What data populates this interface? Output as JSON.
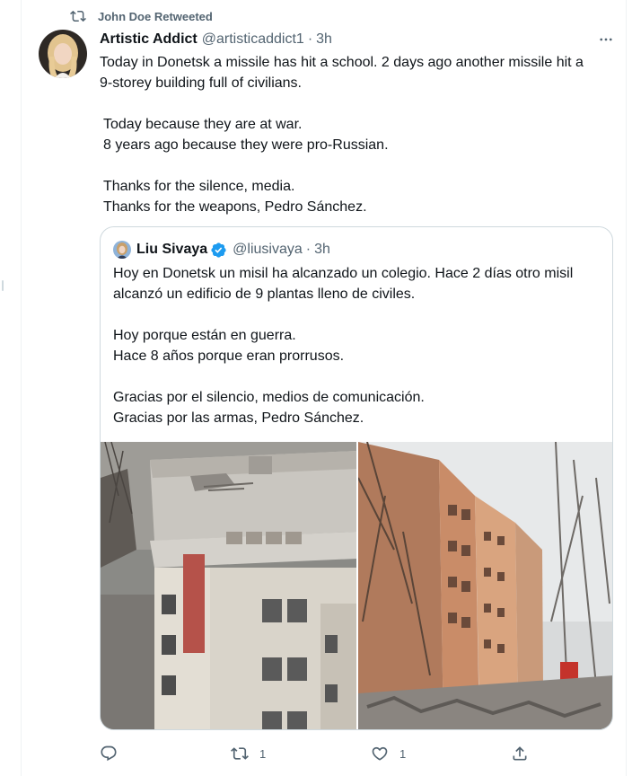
{
  "retweet_context": {
    "icon": "retweet-icon",
    "text": "John Doe Retweeted"
  },
  "tweet": {
    "author": {
      "display_name": "Artistic Addict",
      "handle": "@artisticaddict1",
      "separator": "·",
      "time": "3h"
    },
    "more_icon": "more-horizontal-icon",
    "lines": {
      "l1": "Today in Donetsk a missile has hit a school. 2 days ago another missile hit a",
      "l2": "9-storey building full of civilians.",
      "l3": "Today because they are at war.",
      "l4": "8 years ago because they were pro-Russian.",
      "l5": "Thanks for the silence, media.",
      "l6": "Thanks for the weapons, Pedro Sánchez."
    }
  },
  "quoted_tweet": {
    "author": {
      "display_name": "Liu Sivaya",
      "verified_icon": "verified-badge-icon",
      "handle": "@liusivaya",
      "separator": "·",
      "time": "3h"
    },
    "lines": {
      "l1": "Hoy en Donetsk un misil ha alcanzado un colegio. Hace 2 días otro misil",
      "l2": "alcanzó un edificio de 9 plantas lleno de civiles.",
      "l3": "Hoy porque están en guerra.",
      "l4": "Hace 8 años porque eran prorrusos.",
      "l5": "Gracias por el silencio, medios de comunicación.",
      "l6": "Gracias por las armas, Pedro Sánchez."
    },
    "media": [
      {
        "kind": "photo",
        "subject": "damaged school roof"
      },
      {
        "kind": "photo",
        "subject": "damaged apartment building"
      }
    ]
  },
  "actions": {
    "reply": {
      "icon": "reply-icon",
      "count": ""
    },
    "retweet": {
      "icon": "retweet-icon",
      "count": "1"
    },
    "like": {
      "icon": "heart-icon",
      "count": "1"
    },
    "share": {
      "icon": "share-icon",
      "count": ""
    }
  },
  "colors": {
    "text_primary": "#0f1419",
    "text_secondary": "#536471",
    "border": "#cfd9de",
    "verified": "#1d9bf0"
  }
}
